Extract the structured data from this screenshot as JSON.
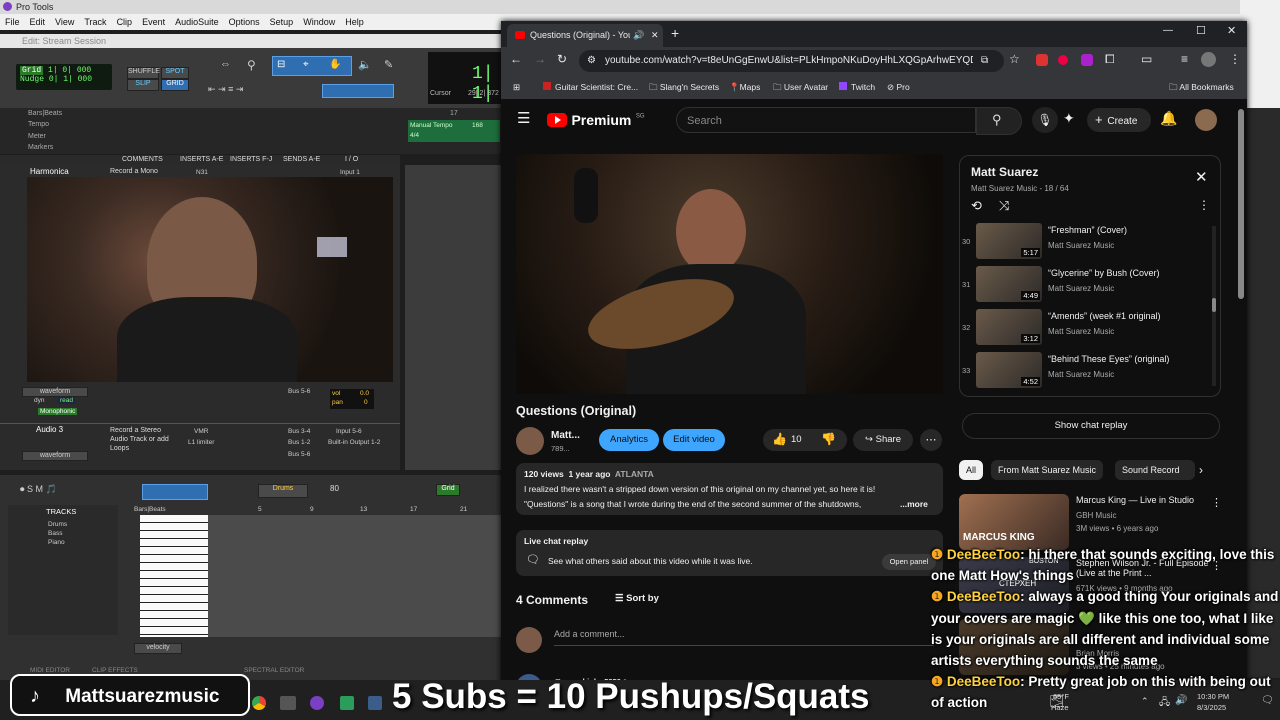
{
  "pro_tools": {
    "app_title": "Pro Tools",
    "menus": [
      "File",
      "Edit",
      "View",
      "Track",
      "Clip",
      "Event",
      "AudioSuite",
      "Options",
      "Setup",
      "Window",
      "Help"
    ],
    "edit_window_title": "Edit: Stream Session",
    "grid_label": "Grid",
    "grid_value": "1| 0| 000",
    "nudge_label": "Nudge",
    "nudge_value": "0| 1| 000",
    "mode_shuffle": "SHUFFLE",
    "mode_spot": "SPOT",
    "mode_slip": "SLIP",
    "mode_grid": "GRID",
    "counter_main": "1| 1|",
    "cursor_label": "Cursor",
    "cursor_value": "29| 2| 372",
    "ruler_bars_beats": "Bars|Beats",
    "ruler_tempo": "Tempo",
    "ruler_meter": "Meter",
    "ruler_markers": "Markers",
    "manual_tempo": "Manual Tempo",
    "tempo_value": "168",
    "meter_value": "4/4",
    "ruler_num_17": "17",
    "mix_headers": [
      "COMMENTS",
      "INSERTS A-E",
      "INSERTS F-J",
      "SENDS A-E",
      "I / O"
    ],
    "track1_name": "Harmonica",
    "track1_comment": "Record a Mono",
    "track1_insert": "N31",
    "track1_input": "Input 1",
    "track1_waveform": "waveform",
    "track1_dyn": "dyn",
    "track1_read": "read",
    "track1_mono": "Monophonic",
    "track1_bus": "Bus 5-6",
    "track1_vol_label": "vol",
    "track1_vol_value": "0.0",
    "track1_pan_label": "pan",
    "track1_pan_value": "0",
    "track2_name": "Audio 3",
    "track2_comment": "Record a Stereo Audio Track or add Loops",
    "track2_ins1": "VMR",
    "track2_ins2": "L1 limiter",
    "track2_bus1": "Bus 3-4",
    "track2_bus2": "Bus 1-2",
    "track2_bus3": "Bus 5-6",
    "track2_in": "Input 5-6",
    "track2_out": "Built-in Output 1-2",
    "track2_waveform": "waveform",
    "midi_track_name": "Drums",
    "midi_tempo": "80",
    "midi_grid": "Grid",
    "tracks_header": "TRACKS",
    "tracks_list": [
      "Drums",
      "Bass",
      "Piano"
    ],
    "midi_ruler": "Bars|Beats",
    "midi_ruler_nums": [
      "5",
      "9",
      "13",
      "17",
      "21"
    ],
    "velocity_label": "velocity",
    "bottom_tabs": [
      "MIDI EDITOR",
      "CLIP EFFECTS",
      "",
      "SPECTRAL EDITOR"
    ]
  },
  "browser": {
    "tab_title": "Questions (Original) - YouT",
    "url": "youtube.com/watch?v=t8eUnGgEnwU&list=PLkHmpoNKuDoyHhLXQGpArhwEYQDJtL3...",
    "bookmarks": [
      "Guitar Scientist: Cre...",
      "Slang'n Secrets",
      "Maps",
      "User Avatar",
      "Twitch",
      "Pro"
    ],
    "all_bookmarks": "All Bookmarks"
  },
  "youtube": {
    "logo_text": "Premium",
    "logo_sup": "SG",
    "search_placeholder": "Search",
    "create_label": "Create",
    "video_title": "Questions (Original)",
    "channel_short": "Matt...",
    "subs_short": "789...",
    "analytics_label": "Analytics",
    "edit_video_label": "Edit video",
    "like_count": "10",
    "share_label": "Share",
    "views": "120 views",
    "age": "1 year ago",
    "location": "ATLANTA",
    "desc_line1": "I realized there wasn't a stripped down version of this original on my channel yet, so here it is!",
    "desc_line2": "\"Questions\" is a song that I wrote during the end of the second summer of the shutdowns,",
    "more_label": "...more",
    "live_replay_title": "Live chat replay",
    "live_replay_text": "See what others said about this video while it was live.",
    "open_panel": "Open panel",
    "comments_count": "4 Comments",
    "sort_by": "Sort by",
    "add_comment": "Add a comment...",
    "first_commenter": "@seanshipley5850",
    "first_comment_age": "1 year ago",
    "playlist_title": "Matt Suarez",
    "playlist_sub": "Matt Suarez Music - 18 / 64",
    "playlist": [
      {
        "num": "30",
        "title": "“Freshman” (Cover)",
        "channel": "Matt Suarez Music",
        "duration": "5:17"
      },
      {
        "num": "31",
        "title": "“Glycerine” by Bush (Cover)",
        "channel": "Matt Suarez Music",
        "duration": "4:49"
      },
      {
        "num": "32",
        "title": "“Amends” (week #1 original)",
        "channel": "Matt Suarez Music",
        "duration": "3:12"
      },
      {
        "num": "33",
        "title": "“Behind These Eyes” (original)",
        "channel": "Matt Suarez Music",
        "duration": "4:52"
      }
    ],
    "show_chat_replay": "Show chat replay",
    "chips": [
      "All",
      "From Matt Suarez Music",
      "Sound Record"
    ],
    "recs": [
      {
        "title": "Marcus King — Live in Studio",
        "channel": "GBH Music",
        "meta": "3M views • 6 years ago",
        "thumb_text": "MARCUS KING"
      },
      {
        "title": "Stephen Wilson Jr. - Full Episode (Live at the Print ...",
        "channel": "",
        "meta": "671K views • 9 months ago",
        "thumb_text": "СТЕРХЕН"
      },
      {
        "title": "",
        "channel": "Brian Morris",
        "meta": "3 views • 25 minutes ago",
        "thumb_text": ""
      }
    ],
    "rec_thumb_brand": "BOSTON"
  },
  "chat_overlay": [
    {
      "user": "DeeBeeToo",
      "text": ": hi there that sounds exciting, love this one Matt How's things"
    },
    {
      "user": "DeeBeeToo",
      "text": ": always a good thing Your originals and your covers are magic 💚 like this one too, what I like is your originals are all different and individual some artists everything sounds the same"
    },
    {
      "user": "DeeBeeToo",
      "text": ": Pretty great job on this with being out of action"
    }
  ],
  "streamer_name": "Mattsuarezmusic",
  "subs_goal": "5 Subs = 10 Pushups/Squats",
  "tray": {
    "temp": "65°F",
    "weather": "Haze",
    "time": "10:30 PM",
    "date": "8/3/2025"
  },
  "colors": {
    "yt_red": "#ff0000",
    "yt_blue": "#3ea6ff",
    "chat_user": "#ffd23f",
    "pt_green": "#6cff6c"
  }
}
